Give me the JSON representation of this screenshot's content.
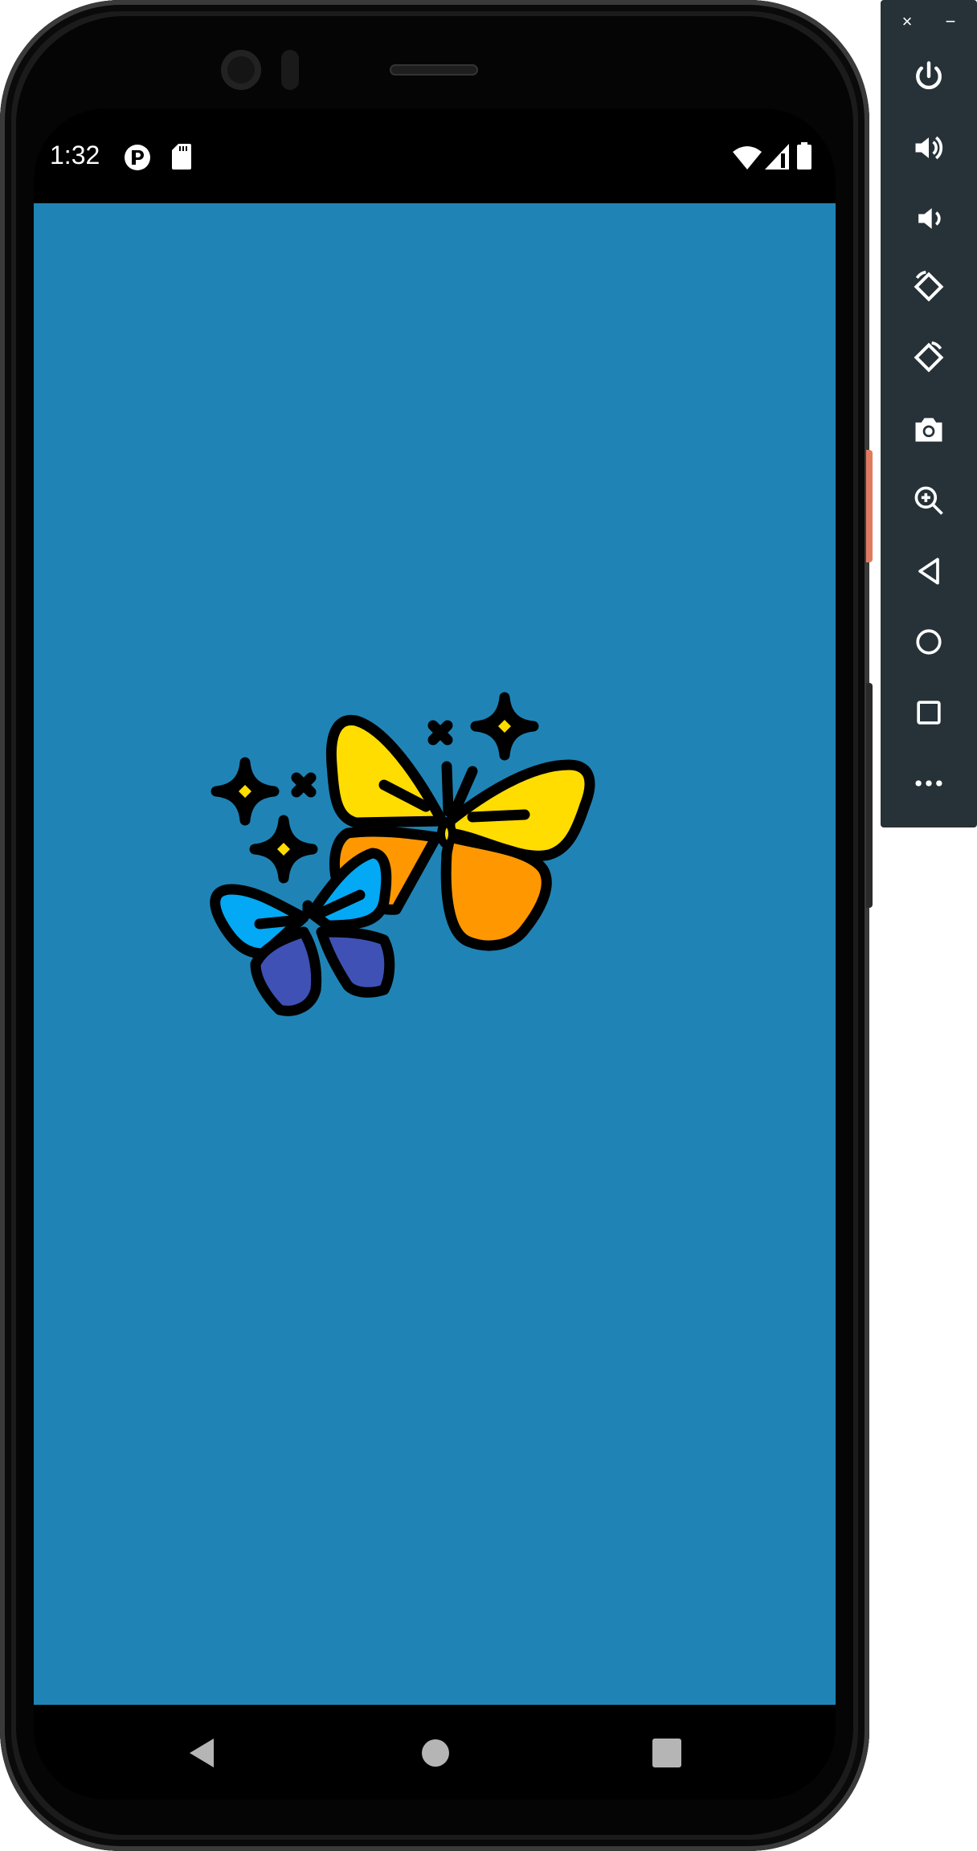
{
  "status_bar": {
    "time": "1:32",
    "icons": [
      "app-notification-icon",
      "sd-card-icon",
      "wifi-icon",
      "signal-icon",
      "battery-icon"
    ]
  },
  "app": {
    "background_color": "#1f84b5",
    "illustration": "butterflies-with-sparkles"
  },
  "nav_bar": {
    "buttons": [
      "back",
      "home",
      "recents"
    ]
  },
  "emulator_toolbar": {
    "window_buttons": {
      "close": "×",
      "minimize": "−"
    },
    "tools": [
      "power",
      "volume-up",
      "volume-down",
      "rotate-left",
      "rotate-right",
      "screenshot",
      "zoom",
      "back",
      "home",
      "overview",
      "more"
    ]
  },
  "colors": {
    "yellow": "#ffdd00",
    "orange": "#ff9800",
    "light_blue": "#03a9f4",
    "indigo": "#3f51b5",
    "toolbar": "#263238"
  }
}
